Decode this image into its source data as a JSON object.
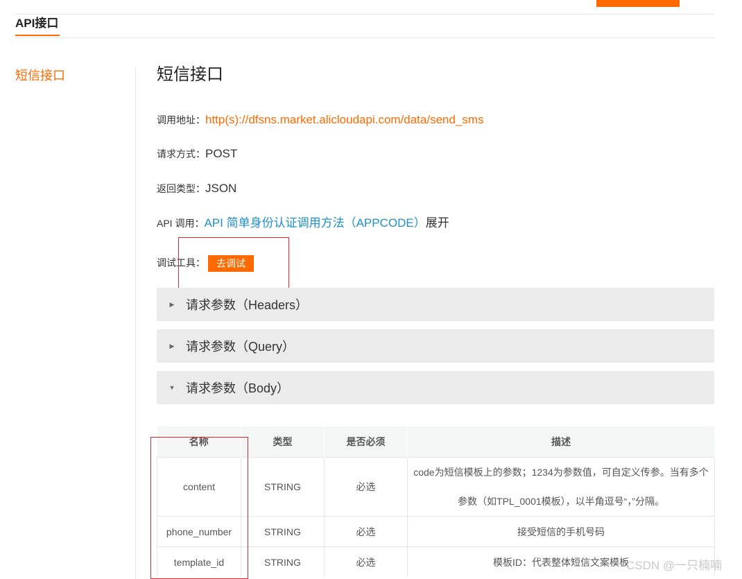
{
  "page": {
    "tab_title": "API接口",
    "sidebar_item": "短信接口",
    "title": "短信接口"
  },
  "fields": {
    "url_label": "调用地址：",
    "url_value": "http(s)://dfsns.market.alicloudapi.com/data/send_sms",
    "method_label": "请求方式：",
    "method_value": "POST",
    "return_label": "返回类型：",
    "return_value": "JSON",
    "api_label": "API 调用：",
    "api_link": "API 简单身份认证调用方法（APPCODE）",
    "api_expand": "展开",
    "debug_label": "调试工具：",
    "debug_button": "去调试"
  },
  "sections": [
    {
      "title": "请求参数（Headers）",
      "expanded": false
    },
    {
      "title": "请求参数（Query）",
      "expanded": false
    },
    {
      "title": "请求参数（Body）",
      "expanded": true
    }
  ],
  "table": {
    "headers": [
      "名称",
      "类型",
      "是否必须",
      "描述"
    ],
    "rows": [
      [
        "content",
        "STRING",
        "必选",
        "code为短信模板上的参数；1234为参数值，可自定义传参。当有多个参数（如TPL_0001模板），以半角逗号“，”分隔。"
      ],
      [
        "phone_number",
        "STRING",
        "必选",
        "接受短信的手机号码"
      ],
      [
        "template_id",
        "STRING",
        "必选",
        "模板ID：代表整体短信文案模板"
      ]
    ]
  },
  "watermark": "CSDN @一只楠喃",
  "colors": {
    "accent": "#ff6a00",
    "link": "#1f8fc9",
    "highlight_box": "#e0242b",
    "section_bg": "#ebebeb"
  },
  "icons": {
    "collapsed": "caret-right-icon",
    "expanded": "caret-down-icon"
  }
}
